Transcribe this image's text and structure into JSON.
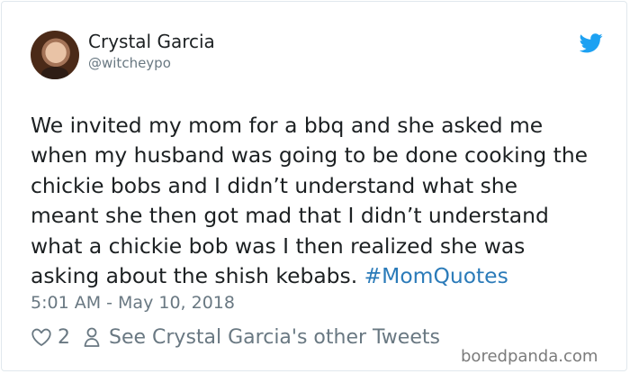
{
  "user": {
    "display_name": "Crystal Garcia",
    "handle": "@witcheypo"
  },
  "tweet": {
    "lines": [
      "We invited my mom for a bbq and she asked me",
      "when my husband was going to be done cooking the",
      "chickie bobs and I didn’t understand what she",
      "meant she then got mad that I didn’t understand",
      "what a chickie bob was I then realized she was",
      "asking about the shish kebabs."
    ],
    "hashtag": "#MomQuotes",
    "timestamp": "5:01 AM - May 10, 2018"
  },
  "actions": {
    "like_count": "2",
    "profile_link": "See Crystal Garcia's other Tweets"
  },
  "watermark": "boredpanda.com",
  "icons": {
    "avatar": "avatar",
    "brand": "twitter-bird-icon",
    "like": "heart-icon",
    "profile": "person-icon"
  },
  "colors": {
    "brand": "#1da1f2",
    "link": "#2b7bb9",
    "muted": "#697882"
  }
}
